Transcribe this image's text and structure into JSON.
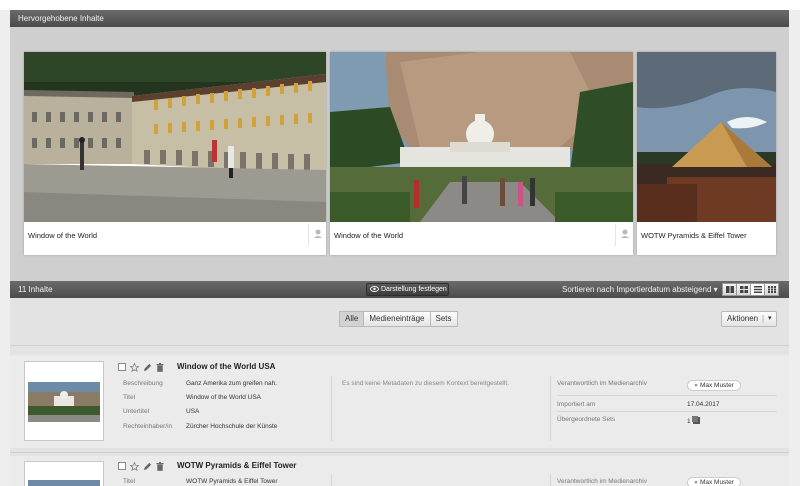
{
  "featured": {
    "title": "Hervorgehobene Inhalte",
    "cards": [
      {
        "caption": "Window of the World"
      },
      {
        "caption": "Window of the World"
      },
      {
        "caption": "WOTW Pyramids & Eiffel Tower"
      }
    ]
  },
  "toolbar": {
    "count": "11 Inhalte",
    "display_button": "Darstellung festlegen",
    "sort_label": "Sortieren nach Importierdatum absteigend ▾",
    "view_modes": [
      "tiles-view-icon",
      "grid-view-icon",
      "list-view-icon",
      "compact-view-icon"
    ],
    "selected_view": "list"
  },
  "filters": {
    "tabs": [
      "Alle",
      "Medieneinträge",
      "Sets"
    ],
    "selected": "Alle"
  },
  "actions_button": "Aktionen",
  "actions_caret": "▾",
  "entries": [
    {
      "title": "Window of the World USA",
      "meta": [
        {
          "key": "Beschreibung",
          "value": "Ganz Amerika zum greifen nah."
        },
        {
          "key": "Titel",
          "value": "Window of the World USA"
        },
        {
          "key": "Untertitel",
          "value": "USA"
        },
        {
          "key": "Rechteinhaber/in",
          "value": "Zürcher Hochschule der Künste"
        }
      ],
      "context_note": "Es sind keine Metadaten zu diesem Kontext bereitgestellt.",
      "responsible_label": "Verantwortlich im Medienarchiv",
      "responsible_person": "Max Muster",
      "imported_label": "Importiert am",
      "imported_date": "17.04.2017",
      "parent_sets_label": "Übergeordnete Sets",
      "parent_sets_count": "1"
    },
    {
      "title": "WOTW Pyramids & Eiffel Tower",
      "meta": [
        {
          "key": "Titel",
          "value": "WOTW Pyramids & Eiffel Tower"
        }
      ],
      "responsible_label": "Verantwortlich im Medienarchiv",
      "responsible_person": "Max Muster"
    }
  ],
  "colors": {
    "header_bar": "#555555",
    "featured_bg": "#cfcfcf",
    "page_bg": "#e3e3e3"
  }
}
